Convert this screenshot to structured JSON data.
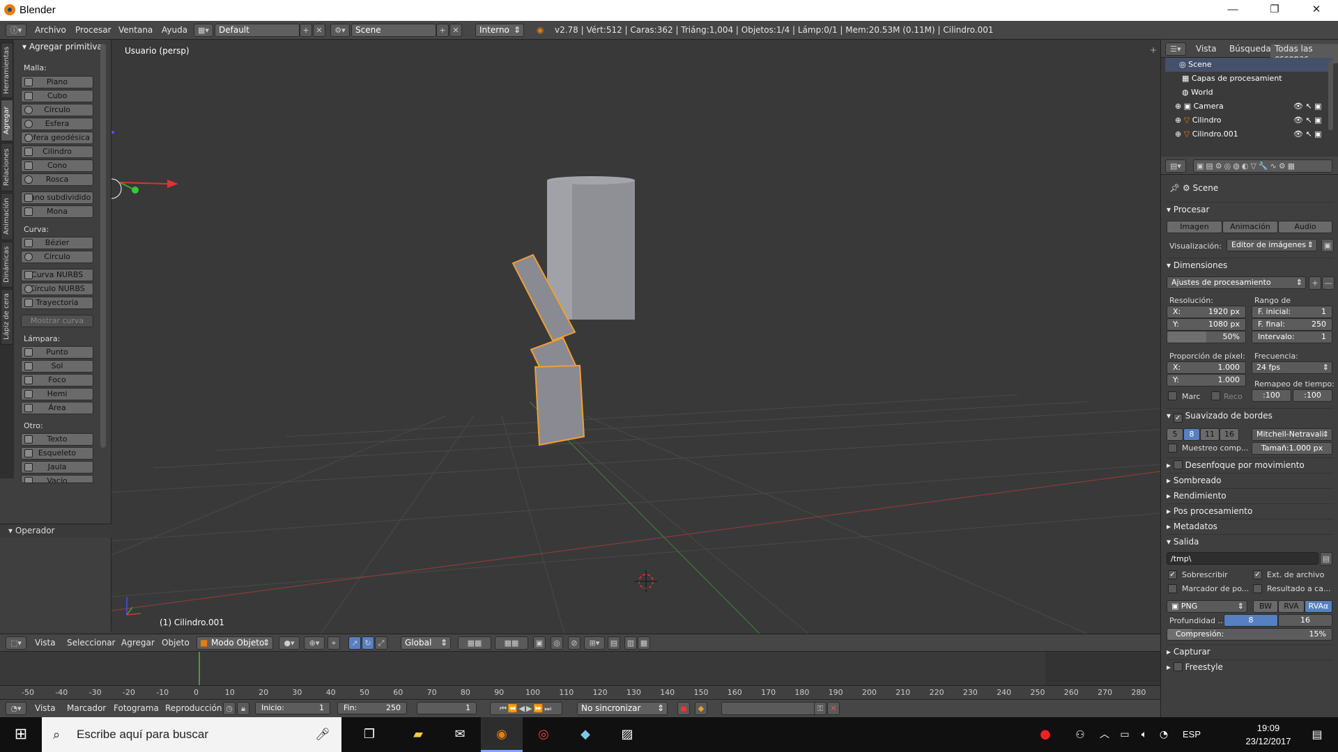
{
  "window": {
    "title": "Blender",
    "minimize": "—",
    "maximize": "❐",
    "close": "✕"
  },
  "infobar": {
    "menus": [
      "Archivo",
      "Procesar",
      "Ventana",
      "Ayuda"
    ],
    "layout": "Default",
    "scene": "Scene",
    "engine": "Interno",
    "stats": "v2.78 | Vért:512 | Caras:362 | Triáng:1,004 | Objetos:1/4 | Lámp:0/1 | Mem:20.53M (0.11M) | Cilindro.001"
  },
  "toolshelf": {
    "tabs": [
      "Herramientas",
      "Agregar",
      "Relaciones",
      "Animación",
      "Dinámicas",
      "Lápiz de cera"
    ],
    "header": "Agregar primitiva",
    "groups": {
      "malla": "Malla:",
      "curva": "Curva:",
      "lampara": "Lámpara:",
      "otro": "Otro:"
    },
    "malla": [
      "Plano",
      "Cubo",
      "Círculo",
      "Esfera",
      "Esfera geodésica",
      "Cilindro",
      "Cono",
      "Rosca",
      "Plano subdividido",
      "Mona"
    ],
    "curva": [
      "Bézier",
      "Círculo",
      "Curva NURBS",
      "Círculo NURBS",
      "Trayectoria",
      "Mostrar curva"
    ],
    "lampara": [
      "Punto",
      "Sol",
      "Foco",
      "Hemi",
      "Área"
    ],
    "otro": [
      "Texto",
      "Esqueleto",
      "Jaula",
      "Vacío"
    ],
    "operator": "Operador"
  },
  "viewport": {
    "view_label": "Usuario (persp)",
    "object_label": "(1) Cilindro.001"
  },
  "viewheader": {
    "menus": [
      "Vista",
      "Seleccionar",
      "Agregar",
      "Objeto"
    ],
    "mode": "Modo Objeto",
    "orientation": "Global"
  },
  "timeline": {
    "ticks": [
      "-50",
      "-40",
      "-30",
      "-20",
      "-10",
      "0",
      "10",
      "20",
      "30",
      "40",
      "50",
      "60",
      "70",
      "80",
      "90",
      "100",
      "110",
      "120",
      "130",
      "140",
      "150",
      "160",
      "170",
      "180",
      "190",
      "200",
      "210",
      "220",
      "230",
      "240",
      "250",
      "260",
      "270",
      "280"
    ],
    "current_frame": 1,
    "menus": [
      "Vista",
      "Marcador",
      "Fotograma",
      "Reproducción"
    ],
    "start": "Inicio:",
    "start_val": "1",
    "end": "Fin:",
    "end_val": "250",
    "frame": "1",
    "sync": "No sincronizar"
  },
  "outliner": {
    "tabs": [
      "Vista",
      "Búsqueda",
      "Todas las escenas"
    ],
    "items": [
      "Scene",
      "Capas de procesamient",
      "World",
      "Camera",
      "Cilindro",
      "Cilindro.001"
    ]
  },
  "properties": {
    "scene": "Scene",
    "procesar": "Procesar",
    "buttons": [
      "Imagen",
      "Animación",
      "Audio"
    ],
    "visualizacion_label": "Visualización:",
    "visualizacion": "Editor de imágenes",
    "dimensiones": "Dimensiones",
    "preset": "Ajustes de procesamiento",
    "resolucion": "Resolución:",
    "res_x": "X:",
    "res_x_val": "1920 px",
    "res_y": "Y:",
    "res_y_val": "1080 px",
    "res_pct": "50%",
    "rango": "Rango de fotogramas:",
    "f_ini": "F. inicial:",
    "f_ini_val": "1",
    "f_fin": "F. final:",
    "f_fin_val": "250",
    "intervalo": "Intervalo:",
    "intervalo_val": "1",
    "proporcion": "Proporción de píxel:",
    "px_x": "X:",
    "px_x_val": "1.000",
    "px_y": "Y:",
    "px_y_val": "1.000",
    "frecuencia": "Frecuencia:",
    "fps": "24 fps",
    "remapeo": "Remapeo de tiempo:",
    "remap_a": ":100",
    "remap_b": ":100",
    "marc": "Marc",
    "reco": "Reco",
    "suavizado": "Suavizado de bordes",
    "aa": [
      "5",
      "8",
      "11",
      "16"
    ],
    "filter": "Mitchell-Netravali",
    "muestreo": "Muestreo comp...",
    "tamano": "Tamañ:1.000 px",
    "desenfoque": "Desenfoque por movimiento",
    "closed_sections": [
      "Sombreado",
      "Rendimiento",
      "Pos procesamiento",
      "Metadatos"
    ],
    "salida": "Salida",
    "path": "/tmp\\",
    "sobrescribir": "Sobrescribir",
    "ext": "Ext. de archivo",
    "marcador": "Marcador de po...",
    "resultado": "Resultado a ca...",
    "format": "PNG",
    "color_modes": [
      "BW",
      "RVA",
      "RVAα"
    ],
    "profundidad": "Profundidad ...",
    "depth": [
      "8",
      "16"
    ],
    "compresion": "Compresión:",
    "compresion_val": "15%",
    "capturar": "Capturar",
    "freestyle": "Freestyle"
  },
  "taskbar": {
    "search": "Escribe aquí para buscar",
    "lang": "ESP",
    "time": "19:09",
    "date": "23/12/2017"
  },
  "colors": {
    "accent": "#5680c2",
    "selection": "#f0a030",
    "orange": "#e87d0d"
  }
}
